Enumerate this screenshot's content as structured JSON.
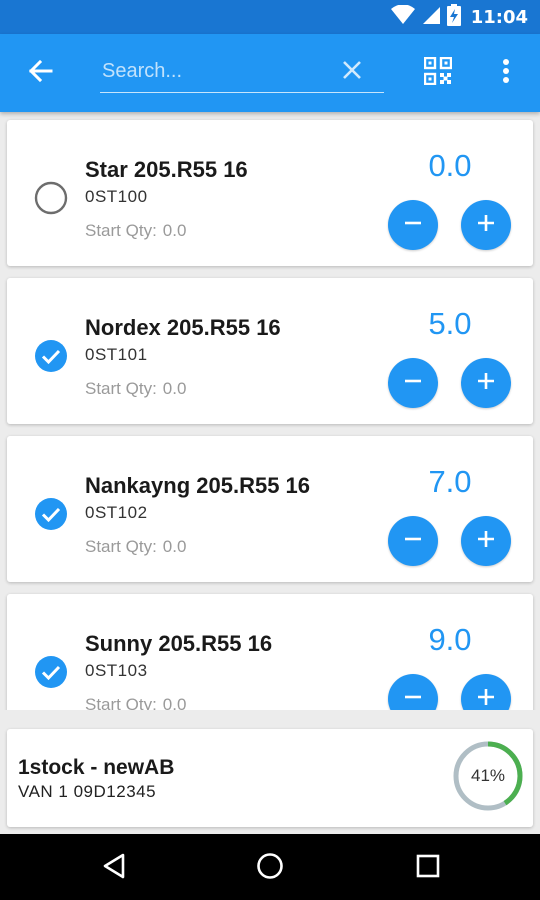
{
  "status_bar": {
    "time": "11:04",
    "icons": [
      "wifi-icon",
      "signal-icon",
      "battery-charging-icon"
    ]
  },
  "toolbar": {
    "back_icon": "arrow-left-icon",
    "search_placeholder": "Search...",
    "search_value": "",
    "clear_icon": "close-icon",
    "scan_icon": "qr-code-icon",
    "menu_icon": "more-vert-icon"
  },
  "items": [
    {
      "name": "Star 205.R55 16",
      "code": "0ST100",
      "start_label": "Start Qty:",
      "start_value": "0.0",
      "qty": "0.0",
      "checked": false
    },
    {
      "name": "Nordex 205.R55 16",
      "code": "0ST101",
      "start_label": "Start Qty:",
      "start_value": "0.0",
      "qty": "5.0",
      "checked": true
    },
    {
      "name": "Nankayng 205.R55 16",
      "code": "0ST102",
      "start_label": "Start Qty:",
      "start_value": "0.0",
      "qty": "7.0",
      "checked": true
    },
    {
      "name": "Sunny 205.R55 16",
      "code": "0ST103",
      "start_label": "Start Qty:",
      "start_value": "0.0",
      "qty": "9.0",
      "checked": true
    }
  ],
  "footer": {
    "title": "1stock - newAB",
    "subtitle": "VAN 1 09D12345",
    "progress_label": "41%",
    "progress_fraction": 0.41
  },
  "nav": {
    "icons": [
      "back-triangle-icon",
      "home-circle-icon",
      "recents-square-icon"
    ]
  },
  "colors": {
    "status_bar": "#1976d2",
    "toolbar": "#2196f3",
    "accent": "#2196f3",
    "progress": "#4caf50",
    "progress_track": "#b0bec5"
  }
}
